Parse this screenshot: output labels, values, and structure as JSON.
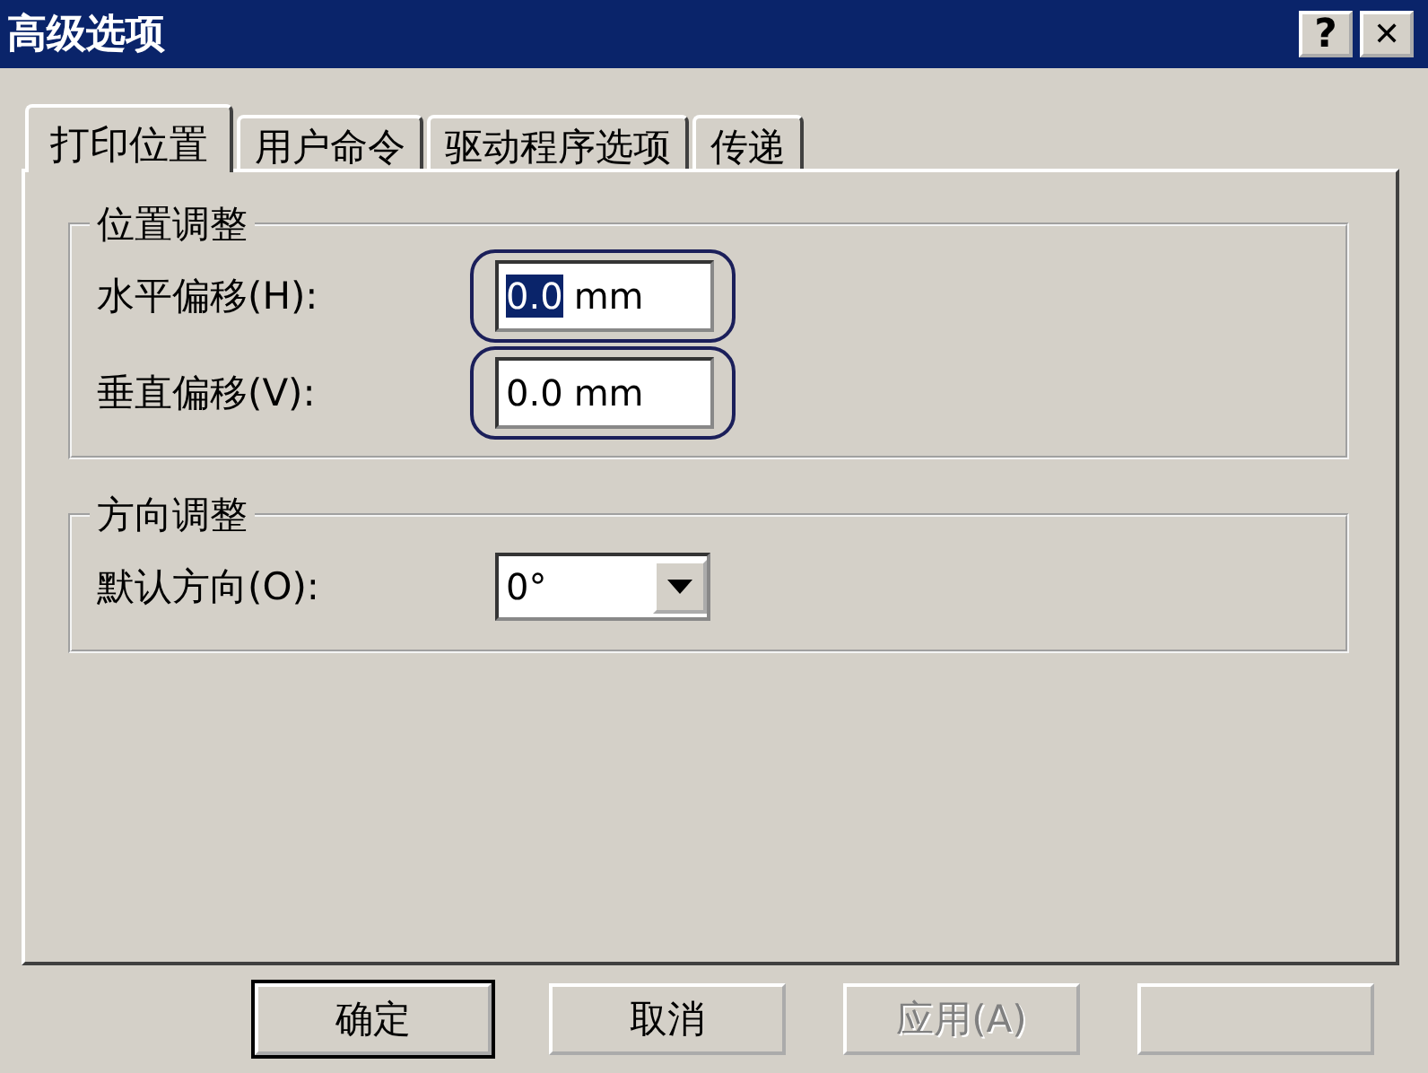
{
  "window": {
    "title": "高级选项",
    "controls": [
      {
        "kind": "help",
        "label": "?"
      },
      {
        "kind": "close",
        "label": "✕"
      }
    ]
  },
  "tabs": [
    {
      "label": "打印位置",
      "selected": true
    },
    {
      "label": "用户命令",
      "selected": false
    },
    {
      "label": "驱动程序选项",
      "selected": false
    },
    {
      "label": "传递",
      "selected": false
    }
  ],
  "groups": [
    {
      "title": "位置调整",
      "rows": [
        {
          "kind": "text",
          "label": "水平偏移(H):",
          "number": "0.0",
          "unit": "mm",
          "text_selected": true,
          "circled": true
        },
        {
          "kind": "text",
          "label": "垂直偏移(V):",
          "number": "0.0",
          "unit": "mm",
          "text_selected": false,
          "circled": true
        }
      ]
    },
    {
      "title": "方向调整",
      "rows": [
        {
          "kind": "dropdown",
          "label": "默认方向(O):",
          "value": "0°"
        }
      ]
    }
  ],
  "buttons": [
    {
      "kind": "push",
      "label": "确定",
      "default": true,
      "disabled": false
    },
    {
      "kind": "push",
      "label": "取消",
      "default": false,
      "disabled": false
    },
    {
      "kind": "push",
      "label": "应用(A)",
      "default": false,
      "disabled": true
    },
    {
      "kind": "blank"
    }
  ]
}
